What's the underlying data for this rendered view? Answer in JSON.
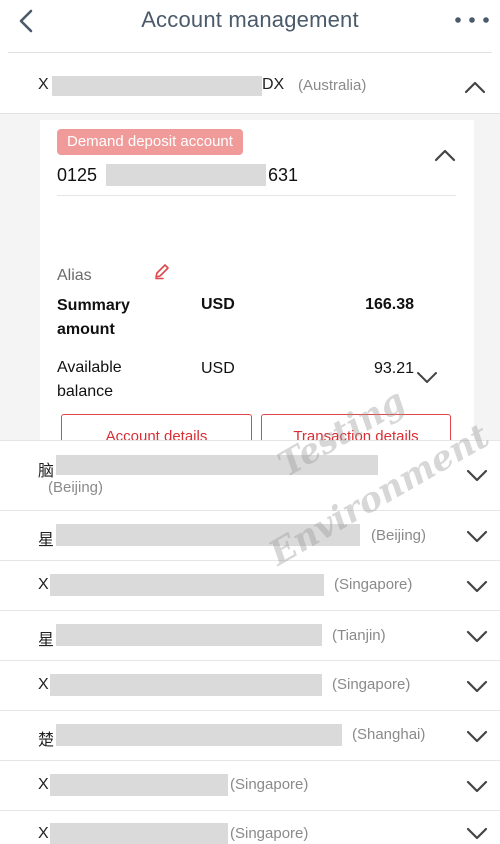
{
  "header": {
    "title": "Account management",
    "back_icon": "back-arrow-icon",
    "more_icon": "more-dots-icon"
  },
  "expanded_account": {
    "name_prefix": "X",
    "name_suffix": "DX",
    "city": "(Australia)",
    "badge": "Demand deposit account",
    "account_prefix": "0125",
    "account_suffix": "631",
    "alias_label": "Alias",
    "summary_label": "Summary amount",
    "summary_currency": "USD",
    "summary_value": "166.38",
    "available_label": "Available balance",
    "available_currency": "USD",
    "available_value": "93.21",
    "account_details_button": "Account details",
    "transaction_details_button": "Transaction details",
    "accent_color": "#e0474c"
  },
  "accounts": [
    {
      "name": "脑",
      "city": "(Beijing)"
    },
    {
      "name": "星",
      "city": "(Beijing)"
    },
    {
      "name": "X",
      "city": "(Singapore)"
    },
    {
      "name": "星",
      "city": "(Tianjin)"
    },
    {
      "name": "X",
      "city": "(Singapore)"
    },
    {
      "name": "楚",
      "city": "(Shanghai)"
    },
    {
      "name": "X",
      "city": "(Singapore)"
    },
    {
      "name": "X",
      "city": "(Singapore)"
    }
  ],
  "watermark": {
    "line1": "Testing",
    "line2": "Environment"
  }
}
